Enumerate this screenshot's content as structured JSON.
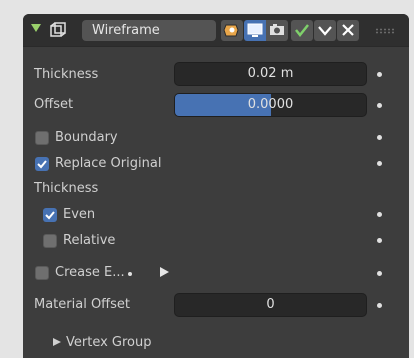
{
  "header": {
    "modifier_name": "Wireframe",
    "icons": [
      "modifier-wrench-icon",
      "edit-mode-icon",
      "viewport-display-icon",
      "render-camera-icon",
      "apply-check-icon",
      "dropdown-chevron-icon",
      "close-x-icon",
      "drag-grip-icon"
    ]
  },
  "fields": {
    "thickness_label": "Thickness",
    "thickness_value": "0.02 m",
    "offset_label": "Offset",
    "offset_value": "0.0000",
    "offset_fill_fraction": 0.5,
    "material_offset_label": "Material Offset",
    "material_offset_value": "0"
  },
  "checkboxes": {
    "boundary": {
      "label": "Boundary",
      "checked": false
    },
    "replace_original": {
      "label": "Replace Original",
      "checked": true
    },
    "even": {
      "label": "Even",
      "checked": true
    },
    "relative": {
      "label": "Relative",
      "checked": false
    },
    "crease_edges": {
      "label": "Crease E...",
      "checked": false
    }
  },
  "sections": {
    "thickness_section_label": "Thickness",
    "vertex_group_label": "Vertex Group"
  },
  "colors": {
    "panel_bg": "#3d3d3d",
    "accent_blue": "#4772b3",
    "toggle_green": "#9ad06b"
  }
}
